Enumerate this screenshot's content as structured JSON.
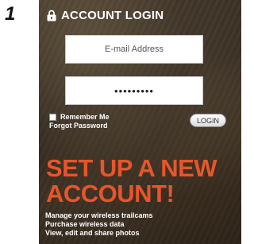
{
  "step": {
    "number": "1"
  },
  "login": {
    "title": "ACCOUNT LOGIN",
    "email_placeholder": "E-mail Address",
    "password_value": "•••••••••",
    "remember_label": "Remember Me",
    "forgot_label": "Forgot Password",
    "login_button": "LOGIN"
  },
  "signup": {
    "heading_line1": "SET UP A NEW",
    "heading_line2": "ACCOUNT!",
    "benefits": [
      "Manage your wireless trailcams",
      "Purchase wireless data",
      "View, edit and share photos"
    ]
  },
  "colors": {
    "accent": "#e8552a",
    "panel_background": "#3a2f22",
    "text": "#ffffff"
  },
  "icons": {
    "lock": "lock-icon",
    "checkbox": "checkbox-icon"
  }
}
